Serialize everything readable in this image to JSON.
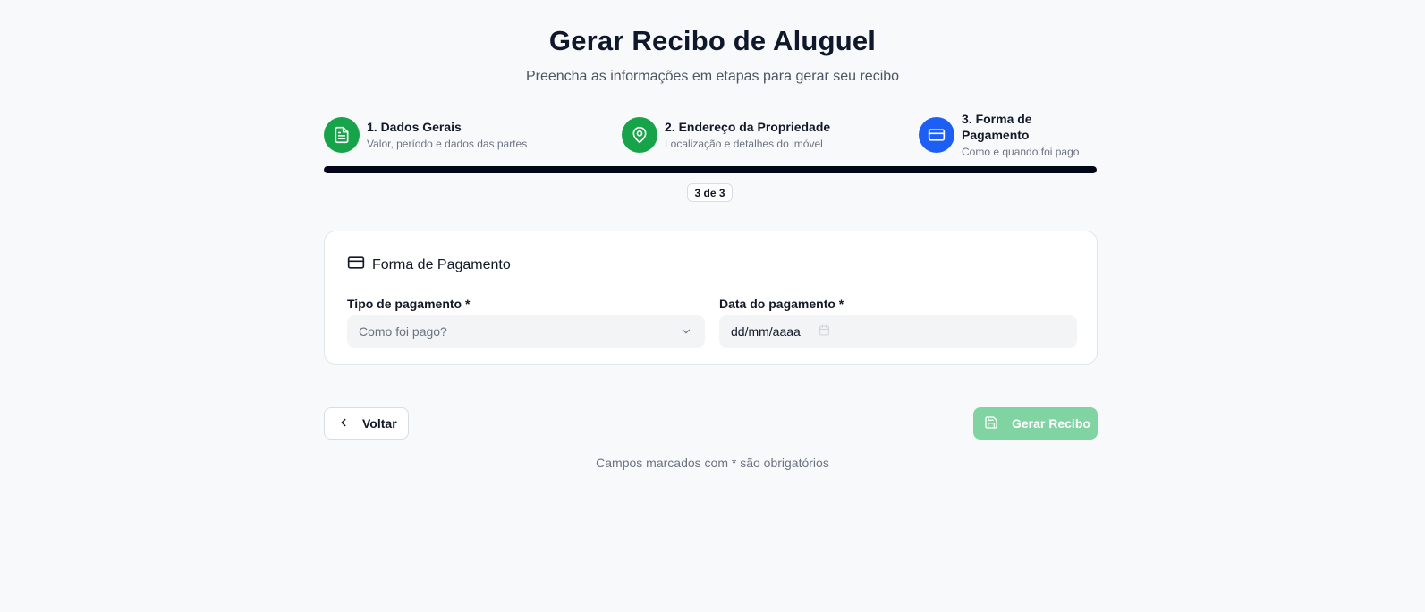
{
  "header": {
    "title": "Gerar Recibo de Aluguel",
    "subtitle": "Preencha as informações em etapas para gerar seu recibo"
  },
  "steps": [
    {
      "title": "1. Dados Gerais",
      "description": "Valor, período e dados das partes",
      "status": "done",
      "icon": "document-icon"
    },
    {
      "title": "2. Endereço da Propriedade",
      "description": "Localização e detalhes do imóvel",
      "status": "done",
      "icon": "map-pin-icon"
    },
    {
      "title": "3. Forma de Pagamento",
      "description": "Como e quando foi pago",
      "status": "active",
      "icon": "credit-card-icon"
    }
  ],
  "progress": {
    "value": 1.0,
    "label": "3 de 3"
  },
  "card": {
    "title": "Forma de Pagamento",
    "icon": "credit-card-icon",
    "fields": {
      "payment_type": {
        "label": "Tipo de pagamento *",
        "placeholder": "Como foi pago?",
        "icon": "chevron-down-icon"
      },
      "payment_date": {
        "label": "Data do pagamento *",
        "value": "dd/mm/aaaa",
        "icon": "calendar-icon"
      }
    }
  },
  "actions": {
    "back_label": "Voltar",
    "back_icon": "chevron-left-icon",
    "generate_label": "Gerar Recibo",
    "generate_icon": "save-icon"
  },
  "footnote": "Campos marcados com * são obrigatórios",
  "colors": {
    "done": "#16a34a",
    "active": "#1d5ff5",
    "progress": "#020617",
    "generate_disabled": "#80d4a1",
    "background": "#f8f9fb"
  }
}
